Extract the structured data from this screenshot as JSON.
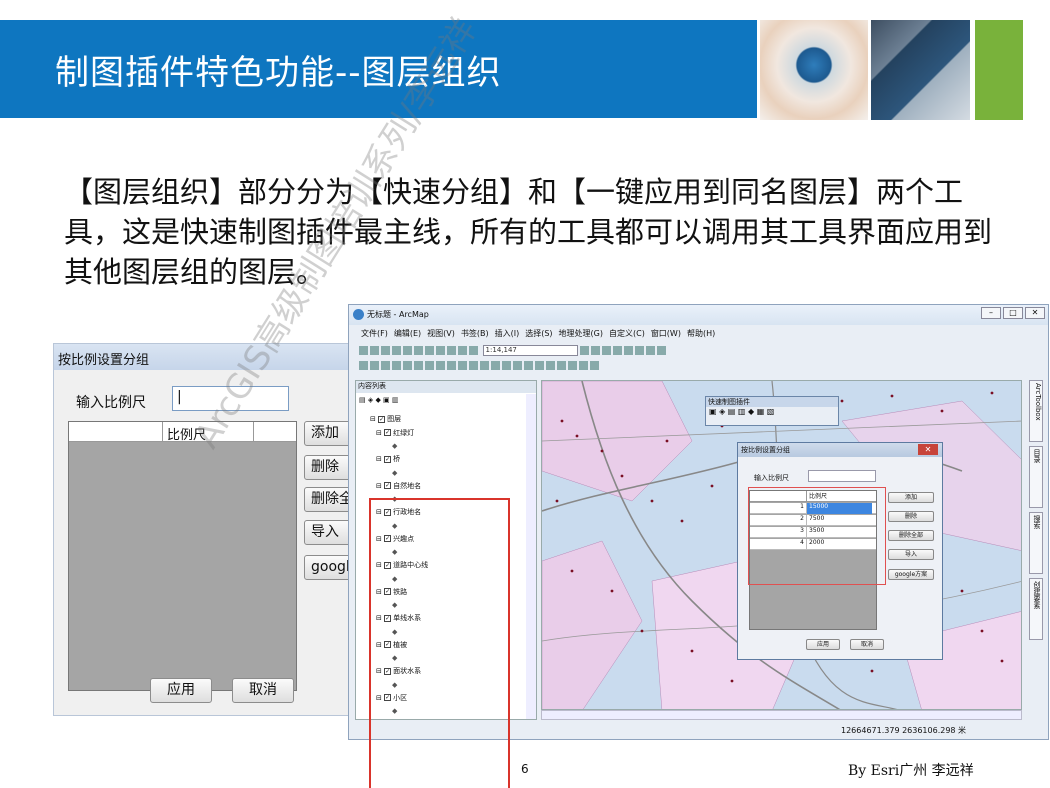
{
  "slide": {
    "title": "制图插件特色功能--图层组织",
    "paragraph": "【图层组织】部分分为【快速分组】和【一键应用到同名图层】两个工具，这是快速制图插件最主线，所有的工具都可以调用其工具界面应用到其他图层组的图层。",
    "page_number": "6",
    "credit": "By Esri广州 李远祥",
    "watermark": "ArcGIS高级制图培训系列/李远祥"
  },
  "left_dialog": {
    "title": "按比例设置分组",
    "input_label": "输入比例尺",
    "input_value": "|",
    "grid_header": "比例尺",
    "btn_add": "添加",
    "btn_delete": "删除",
    "btn_delete_all": "删除全部",
    "btn_import": "导入",
    "btn_google": "google方案",
    "btn_apply": "应用",
    "btn_cancel": "取消"
  },
  "arcmap": {
    "window_title": "无标题 - ArcMap",
    "menu": [
      "文件(F)",
      "编辑(E)",
      "视图(V)",
      "书签(B)",
      "插入(I)",
      "选择(S)",
      "地理处理(G)",
      "自定义(C)",
      "窗口(W)",
      "帮助(H)"
    ],
    "scale": "1:14,147",
    "toc_title": "内容列表",
    "toc_root": "图层",
    "layers": [
      "红绿灯",
      "桥",
      "自然地名",
      "行政地名",
      "兴趣点",
      "道路中心线",
      "铁路",
      "单线水系",
      "植被",
      "面状水系",
      "小区"
    ],
    "right_tools": [
      "ArcToolbox",
      "目录",
      "搜索",
      "创建要素"
    ],
    "coordinates": "12664671.379  2636106.298 米",
    "quick_panel_title": "快速制图插件",
    "inner_dialog": {
      "title": "按比例设置分组",
      "input_label": "输入比例尺",
      "grid_header": "比例尺",
      "rows": [
        {
          "index": "1",
          "value": "15000"
        },
        {
          "index": "2",
          "value": "7500"
        },
        {
          "index": "3",
          "value": "3500"
        },
        {
          "index": "4",
          "value": "2000"
        }
      ],
      "btn_add": "添加",
      "btn_delete": "删除",
      "btn_delete_all": "删除全部",
      "btn_import": "导入",
      "btn_google": "google方案",
      "btn_apply": "应用",
      "btn_cancel": "取消"
    }
  },
  "colors": {
    "header_blue": "#0e76c0",
    "accent_green": "#79b23b",
    "highlight_red": "#d9342b"
  }
}
